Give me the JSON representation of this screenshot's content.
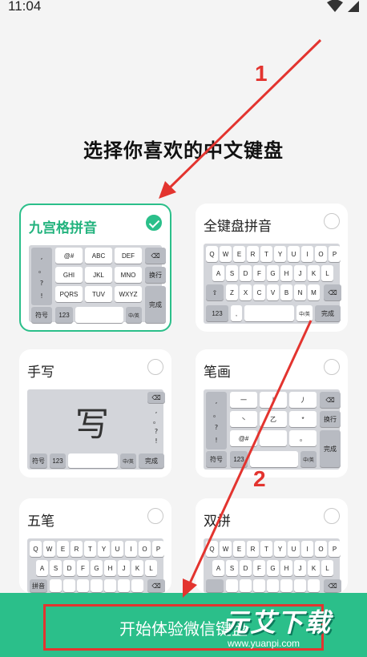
{
  "status": {
    "time": "11:04"
  },
  "title": "选择你喜欢的中文键盘",
  "cards": [
    {
      "title": "九宫格拼音",
      "selected": true
    },
    {
      "title": "全键盘拼音",
      "selected": false
    },
    {
      "title": "手写",
      "selected": false
    },
    {
      "title": "笔画",
      "selected": false
    },
    {
      "title": "五笔",
      "selected": false
    },
    {
      "title": "双拼",
      "selected": false
    }
  ],
  "jiugong": {
    "side": [
      ",",
      "。",
      "?",
      "!"
    ],
    "rows": [
      [
        "@#",
        "ABC",
        "DEF"
      ],
      [
        "GHI",
        "JKL",
        "MNO"
      ],
      [
        "PQRS",
        "TUV",
        "WXYZ"
      ]
    ],
    "right": [
      "换行",
      "完成"
    ],
    "bottom": [
      "符号",
      "123",
      "中/英"
    ]
  },
  "qwerty": {
    "row1": [
      "Q",
      "W",
      "E",
      "R",
      "T",
      "Y",
      "U",
      "I",
      "O",
      "P"
    ],
    "row2": [
      "A",
      "S",
      "D",
      "F",
      "G",
      "H",
      "J",
      "K",
      "L"
    ],
    "row3": [
      "Z",
      "X",
      "C",
      "V",
      "B",
      "N",
      "M"
    ],
    "bottom": [
      "123",
      ",",
      "中/英",
      "完成"
    ]
  },
  "handwrite": {
    "glyph": "写",
    "side": [
      ",",
      "。",
      "?",
      "!"
    ],
    "bottom": [
      "符号",
      "123",
      "中/英",
      "完成"
    ]
  },
  "stroke": {
    "side": [
      ",",
      "。",
      "?",
      "!"
    ],
    "rows": [
      [
        "一",
        "丨",
        "丿"
      ],
      [
        "丶",
        "乙",
        "*"
      ],
      [
        "@#",
        "",
        "。"
      ]
    ],
    "right": [
      "换行",
      "完成"
    ],
    "bottom": [
      "符号",
      "123",
      "中/英"
    ]
  },
  "wubi": {
    "row1": [
      "Q",
      "W",
      "E",
      "R",
      "T",
      "Y",
      "U",
      "I",
      "O",
      "P"
    ],
    "row2": [
      "A",
      "S",
      "D",
      "F",
      "G",
      "H",
      "J",
      "K",
      "L"
    ],
    "row3_left": "拼音"
  },
  "cta": {
    "label": "开始体验微信键盘"
  },
  "annotations": {
    "step1": "1",
    "step2": "2"
  },
  "watermark": {
    "logo": "元艾下载",
    "url": "www.yuanpi.com"
  },
  "colors": {
    "accent": "#2bbf8a",
    "annotation": "#e3342f"
  }
}
